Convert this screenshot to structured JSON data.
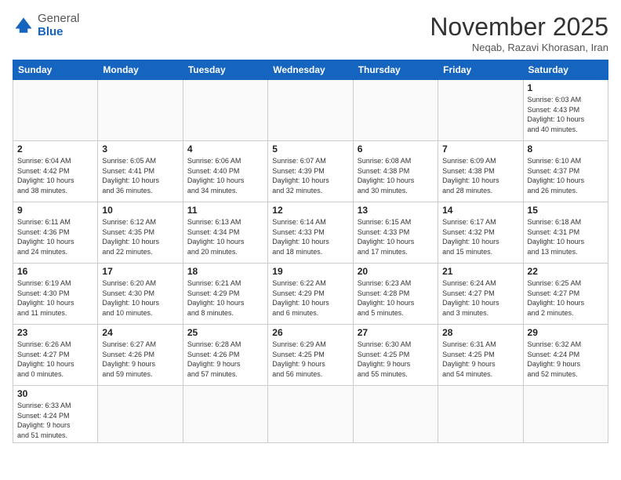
{
  "header": {
    "logo_line1": "General",
    "logo_line2": "Blue",
    "month": "November 2025",
    "location": "Neqab, Razavi Khorasan, Iran"
  },
  "weekdays": [
    "Sunday",
    "Monday",
    "Tuesday",
    "Wednesday",
    "Thursday",
    "Friday",
    "Saturday"
  ],
  "weeks": [
    [
      {
        "day": "",
        "info": ""
      },
      {
        "day": "",
        "info": ""
      },
      {
        "day": "",
        "info": ""
      },
      {
        "day": "",
        "info": ""
      },
      {
        "day": "",
        "info": ""
      },
      {
        "day": "",
        "info": ""
      },
      {
        "day": "1",
        "info": "Sunrise: 6:03 AM\nSunset: 4:43 PM\nDaylight: 10 hours\nand 40 minutes."
      }
    ],
    [
      {
        "day": "2",
        "info": "Sunrise: 6:04 AM\nSunset: 4:42 PM\nDaylight: 10 hours\nand 38 minutes."
      },
      {
        "day": "3",
        "info": "Sunrise: 6:05 AM\nSunset: 4:41 PM\nDaylight: 10 hours\nand 36 minutes."
      },
      {
        "day": "4",
        "info": "Sunrise: 6:06 AM\nSunset: 4:40 PM\nDaylight: 10 hours\nand 34 minutes."
      },
      {
        "day": "5",
        "info": "Sunrise: 6:07 AM\nSunset: 4:39 PM\nDaylight: 10 hours\nand 32 minutes."
      },
      {
        "day": "6",
        "info": "Sunrise: 6:08 AM\nSunset: 4:38 PM\nDaylight: 10 hours\nand 30 minutes."
      },
      {
        "day": "7",
        "info": "Sunrise: 6:09 AM\nSunset: 4:38 PM\nDaylight: 10 hours\nand 28 minutes."
      },
      {
        "day": "8",
        "info": "Sunrise: 6:10 AM\nSunset: 4:37 PM\nDaylight: 10 hours\nand 26 minutes."
      }
    ],
    [
      {
        "day": "9",
        "info": "Sunrise: 6:11 AM\nSunset: 4:36 PM\nDaylight: 10 hours\nand 24 minutes."
      },
      {
        "day": "10",
        "info": "Sunrise: 6:12 AM\nSunset: 4:35 PM\nDaylight: 10 hours\nand 22 minutes."
      },
      {
        "day": "11",
        "info": "Sunrise: 6:13 AM\nSunset: 4:34 PM\nDaylight: 10 hours\nand 20 minutes."
      },
      {
        "day": "12",
        "info": "Sunrise: 6:14 AM\nSunset: 4:33 PM\nDaylight: 10 hours\nand 18 minutes."
      },
      {
        "day": "13",
        "info": "Sunrise: 6:15 AM\nSunset: 4:33 PM\nDaylight: 10 hours\nand 17 minutes."
      },
      {
        "day": "14",
        "info": "Sunrise: 6:17 AM\nSunset: 4:32 PM\nDaylight: 10 hours\nand 15 minutes."
      },
      {
        "day": "15",
        "info": "Sunrise: 6:18 AM\nSunset: 4:31 PM\nDaylight: 10 hours\nand 13 minutes."
      }
    ],
    [
      {
        "day": "16",
        "info": "Sunrise: 6:19 AM\nSunset: 4:30 PM\nDaylight: 10 hours\nand 11 minutes."
      },
      {
        "day": "17",
        "info": "Sunrise: 6:20 AM\nSunset: 4:30 PM\nDaylight: 10 hours\nand 10 minutes."
      },
      {
        "day": "18",
        "info": "Sunrise: 6:21 AM\nSunset: 4:29 PM\nDaylight: 10 hours\nand 8 minutes."
      },
      {
        "day": "19",
        "info": "Sunrise: 6:22 AM\nSunset: 4:29 PM\nDaylight: 10 hours\nand 6 minutes."
      },
      {
        "day": "20",
        "info": "Sunrise: 6:23 AM\nSunset: 4:28 PM\nDaylight: 10 hours\nand 5 minutes."
      },
      {
        "day": "21",
        "info": "Sunrise: 6:24 AM\nSunset: 4:27 PM\nDaylight: 10 hours\nand 3 minutes."
      },
      {
        "day": "22",
        "info": "Sunrise: 6:25 AM\nSunset: 4:27 PM\nDaylight: 10 hours\nand 2 minutes."
      }
    ],
    [
      {
        "day": "23",
        "info": "Sunrise: 6:26 AM\nSunset: 4:27 PM\nDaylight: 10 hours\nand 0 minutes."
      },
      {
        "day": "24",
        "info": "Sunrise: 6:27 AM\nSunset: 4:26 PM\nDaylight: 9 hours\nand 59 minutes."
      },
      {
        "day": "25",
        "info": "Sunrise: 6:28 AM\nSunset: 4:26 PM\nDaylight: 9 hours\nand 57 minutes."
      },
      {
        "day": "26",
        "info": "Sunrise: 6:29 AM\nSunset: 4:25 PM\nDaylight: 9 hours\nand 56 minutes."
      },
      {
        "day": "27",
        "info": "Sunrise: 6:30 AM\nSunset: 4:25 PM\nDaylight: 9 hours\nand 55 minutes."
      },
      {
        "day": "28",
        "info": "Sunrise: 6:31 AM\nSunset: 4:25 PM\nDaylight: 9 hours\nand 54 minutes."
      },
      {
        "day": "29",
        "info": "Sunrise: 6:32 AM\nSunset: 4:24 PM\nDaylight: 9 hours\nand 52 minutes."
      }
    ],
    [
      {
        "day": "30",
        "info": "Sunrise: 6:33 AM\nSunset: 4:24 PM\nDaylight: 9 hours\nand 51 minutes."
      },
      {
        "day": "",
        "info": ""
      },
      {
        "day": "",
        "info": ""
      },
      {
        "day": "",
        "info": ""
      },
      {
        "day": "",
        "info": ""
      },
      {
        "day": "",
        "info": ""
      },
      {
        "day": "",
        "info": ""
      }
    ]
  ]
}
